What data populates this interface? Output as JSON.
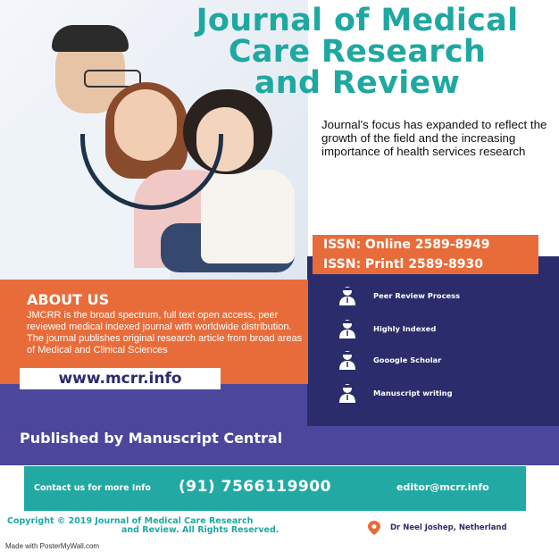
{
  "title": {
    "line1": "Journal of Medical",
    "line2": "Care Research",
    "line3": "and Review"
  },
  "focus_text": "Journal's focus has expanded to reflect the growth of the field and the increasing importance of health services research",
  "issn": {
    "online": "ISSN:  Online 2589-8949",
    "print": "ISSN:  Printl  2589-8930"
  },
  "about": {
    "heading": "ABOUT US",
    "body": "JMCRR is the broad spectrum, full text open access, peer reviewed medical indexed journal with worldwide distribution. The journal publishes original research article from broad areas of Medical and Clinical Sciences",
    "url": "www.mcrr.info"
  },
  "features": [
    {
      "label": "Peer Review Process",
      "icon": "doctor-icon"
    },
    {
      "label": "Highly Indexed",
      "icon": "doctor-icon"
    },
    {
      "label": "Gooogle Scholar",
      "icon": "doctor-icon"
    },
    {
      "label": "Manuscript writing",
      "icon": "doctor-icon"
    }
  ],
  "published_by": "Published by Manuscript Central",
  "contact": {
    "label": "Contact us for more Info",
    "phone": "(91) 7566119900",
    "email": "editor@mcrr.info"
  },
  "copyright": {
    "line1": "Copyright © 2019 Journal of Medical Care Research",
    "line2": "and Review. All Rights Reserved."
  },
  "location_name": "Dr Neel Joshep, Netherland",
  "made_with": "Made with PosterMyWall.com",
  "colors": {
    "teal": "#1fa8a1",
    "orange": "#e86c3a",
    "navy": "#2b2c6b",
    "purple": "#4c479d"
  }
}
